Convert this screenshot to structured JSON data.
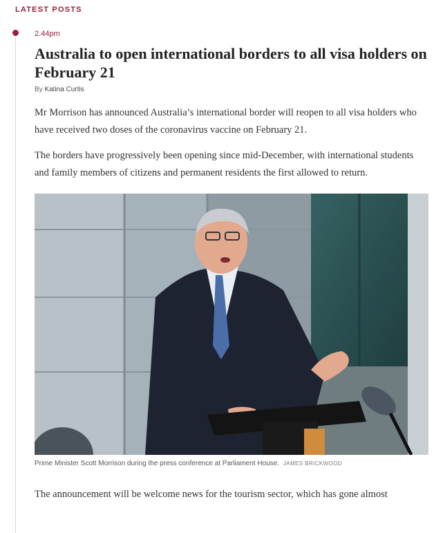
{
  "section": {
    "label": "LATEST POSTS"
  },
  "post": {
    "time": "2.44pm",
    "title": "Australia to open international borders to all visa holders on February 21",
    "byline_prefix": "By",
    "author": "Katina Curtis",
    "paragraphs": [
      "Mr Morrison has announced Australia’s international border will reopen to all visa holders who have received two doses of the coronavirus vaccine on February 21.",
      "The borders have progressively been opening since mid-December, with international students and family members of citizens and permanent residents the first allowed to return.",
      "The announcement will be welcome news for the tourism sector, which has gone almost"
    ],
    "image": {
      "subject": "man-speaking-at-lectern-photo"
    },
    "caption": "Prime Minister Scott Morrison during the press conference at Parliament House.",
    "credit": "JAMES BRICKWOOD"
  },
  "colors": {
    "accent": "#9a1d3a",
    "timeline": "#e2d6da",
    "text": "#333333"
  }
}
